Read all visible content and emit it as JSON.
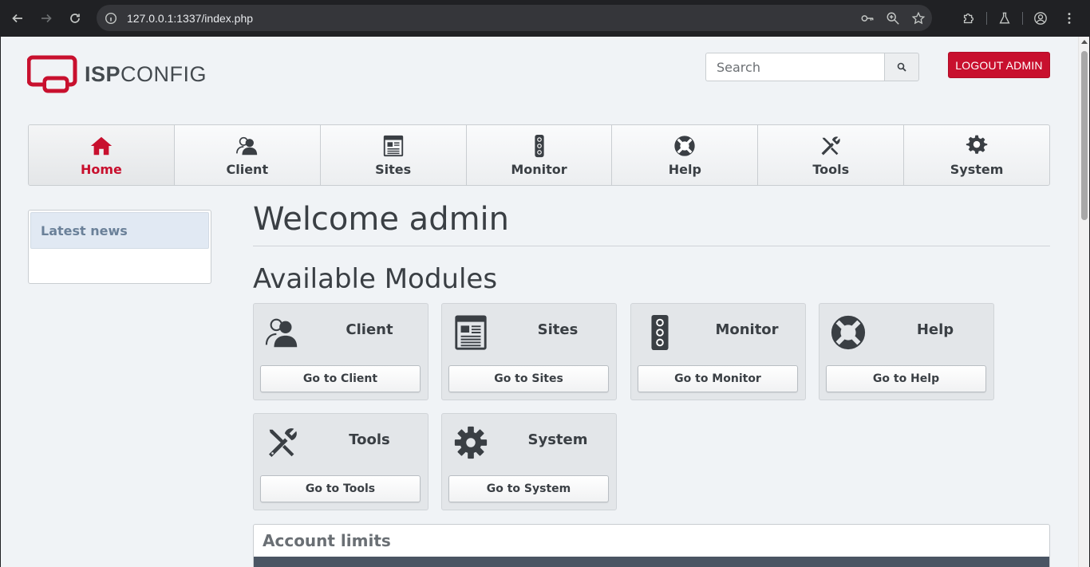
{
  "browser": {
    "url": "127.0.0.1:1337/index.php"
  },
  "header": {
    "logo_bold": "ISP",
    "logo_light": "CONFIG",
    "search_placeholder": "Search",
    "logout_label": "LOGOUT ADMIN"
  },
  "mainnav": {
    "items": [
      {
        "label": "Home",
        "icon": "home-icon",
        "active": true
      },
      {
        "label": "Client",
        "icon": "users-icon"
      },
      {
        "label": "Sites",
        "icon": "sites-icon"
      },
      {
        "label": "Monitor",
        "icon": "traffic-light-icon"
      },
      {
        "label": "Help",
        "icon": "lifebuoy-icon"
      },
      {
        "label": "Tools",
        "icon": "tools-icon"
      },
      {
        "label": "System",
        "icon": "gear-icon"
      }
    ]
  },
  "sidebar": {
    "title": "Latest news"
  },
  "content": {
    "welcome": "Welcome admin",
    "modules_heading": "Available Modules",
    "modules": [
      {
        "title": "Client",
        "button": "Go to Client",
        "icon": "users-icon"
      },
      {
        "title": "Sites",
        "button": "Go to Sites",
        "icon": "sites-icon"
      },
      {
        "title": "Monitor",
        "button": "Go to Monitor",
        "icon": "traffic-light-icon"
      },
      {
        "title": "Help",
        "button": "Go to Help",
        "icon": "lifebuoy-icon"
      },
      {
        "title": "Tools",
        "button": "Go to Tools",
        "icon": "tools-icon"
      },
      {
        "title": "System",
        "button": "Go to System",
        "icon": "gear-icon"
      }
    ],
    "account_limits": "Account limits"
  },
  "colors": {
    "brand_red": "#c8102e",
    "text_dark": "#3a3f44",
    "page_bg": "#f0f3f6"
  }
}
